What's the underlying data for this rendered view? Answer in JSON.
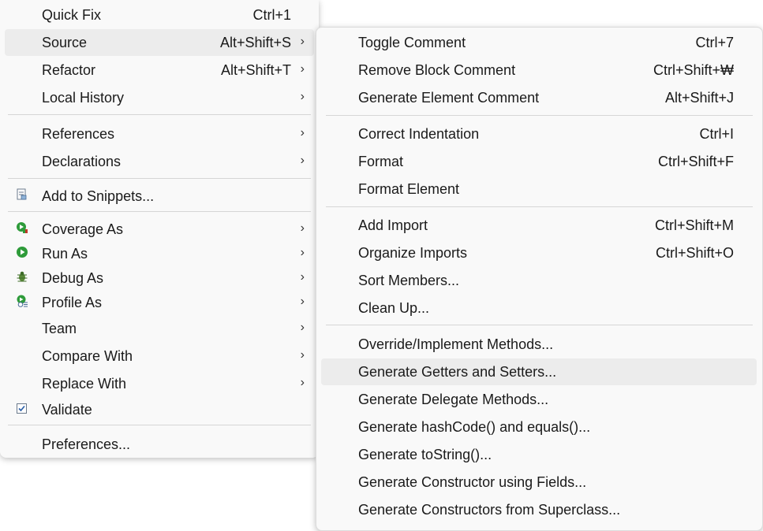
{
  "left_menu": {
    "items": [
      {
        "label": "Quick Fix",
        "shortcut": "Ctrl+1"
      },
      {
        "label": "Source",
        "shortcut": "Alt+Shift+S"
      },
      {
        "label": "Refactor",
        "shortcut": "Alt+Shift+T"
      },
      {
        "label": "Local History"
      },
      {
        "label": "References"
      },
      {
        "label": "Declarations"
      },
      {
        "label": "Add to Snippets...",
        "icon": "snippet-icon"
      },
      {
        "label": "Coverage As",
        "icon": "coverage-icon"
      },
      {
        "label": "Run As",
        "icon": "run-icon"
      },
      {
        "label": "Debug As",
        "icon": "debug-bug-icon"
      },
      {
        "label": "Profile As",
        "icon": "profile-icon"
      },
      {
        "label": "Team"
      },
      {
        "label": "Compare With"
      },
      {
        "label": "Replace With"
      },
      {
        "label": "Validate",
        "icon": "checkbox-icon"
      },
      {
        "label": "Preferences..."
      }
    ],
    "submenu_arrow": "›"
  },
  "source_submenu": {
    "items": [
      {
        "label": "Toggle Comment",
        "shortcut": "Ctrl+7"
      },
      {
        "label": "Remove Block Comment",
        "shortcut": "Ctrl+Shift+₩"
      },
      {
        "label": "Generate Element Comment",
        "shortcut": "Alt+Shift+J"
      },
      {
        "label": "Correct Indentation",
        "shortcut": "Ctrl+I"
      },
      {
        "label": "Format",
        "shortcut": "Ctrl+Shift+F"
      },
      {
        "label": "Format Element"
      },
      {
        "label": "Add Import",
        "shortcut": "Ctrl+Shift+M"
      },
      {
        "label": "Organize Imports",
        "shortcut": "Ctrl+Shift+O"
      },
      {
        "label": "Sort Members..."
      },
      {
        "label": "Clean Up..."
      },
      {
        "label": "Override/Implement Methods..."
      },
      {
        "label": "Generate Getters and Setters..."
      },
      {
        "label": "Generate Delegate Methods..."
      },
      {
        "label": "Generate hashCode() and equals()..."
      },
      {
        "label": "Generate toString()..."
      },
      {
        "label": "Generate Constructor using Fields..."
      },
      {
        "label": "Generate Constructors from Superclass..."
      }
    ]
  },
  "colors": {
    "menu_background": "#f9f9f9",
    "highlight": "#ececec",
    "separator": "#d6d6d6",
    "run_green": "#2e9b3a"
  }
}
